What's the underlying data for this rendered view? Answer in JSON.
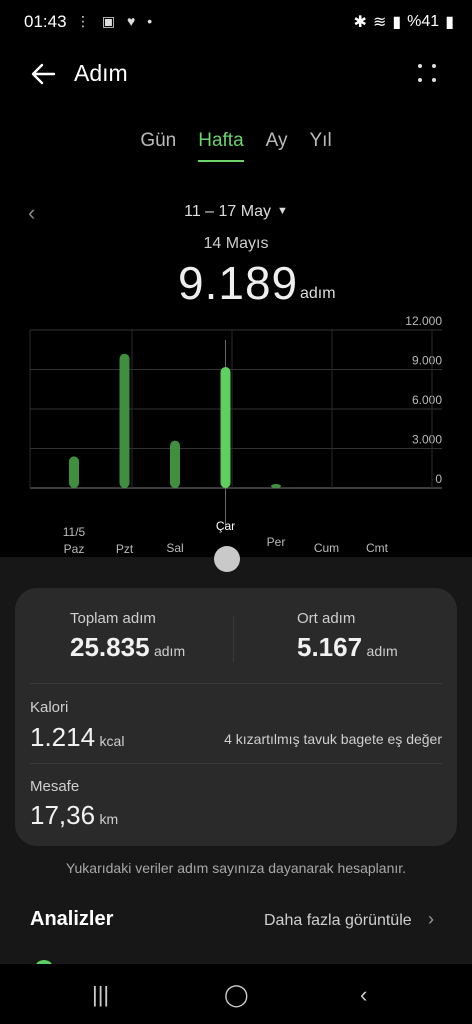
{
  "status_bar": {
    "time": "01:43",
    "left_icons": "⋮ ▣ ♥ •",
    "right_text": "%41"
  },
  "header": {
    "title": "Adım"
  },
  "tabs": [
    {
      "label": "Gün",
      "active": false
    },
    {
      "label": "Hafta",
      "active": true
    },
    {
      "label": "Ay",
      "active": false
    },
    {
      "label": "Yıl",
      "active": false
    }
  ],
  "range": {
    "label": "11 – 17 May"
  },
  "selected": {
    "day": "14 Mayıs",
    "value": "9.189",
    "unit": "adım"
  },
  "chart_data": {
    "type": "bar",
    "categories": [
      "Paz",
      "Pzt",
      "Sal",
      "Çar",
      "Per",
      "Cum",
      "Cmt"
    ],
    "date_label": "11/5",
    "values": [
      2400,
      10200,
      3600,
      9189,
      300,
      0,
      0
    ],
    "ylim": [
      0,
      12000
    ],
    "yticks": [
      "12.000",
      "9.000",
      "6.000",
      "3.000",
      "0"
    ],
    "selected_index": 3,
    "bar_color": "#3f8f3f",
    "selected_color": "#5fcf5f"
  },
  "summary": {
    "total_label": "Toplam adım",
    "total_value": "25.835",
    "total_unit": "adım",
    "avg_label": "Ort adım",
    "avg_value": "5.167",
    "avg_unit": "adım",
    "calorie_label": "Kalori",
    "calorie_value": "1.214",
    "calorie_unit": "kcal",
    "calorie_equiv": "4 kızartılmış tavuk bagete eş değer",
    "distance_label": "Mesafe",
    "distance_value": "17,36",
    "distance_unit": "km"
  },
  "footnote": "Yukarıdaki veriler adım sayınıza dayanarak hesaplanır.",
  "analysis": {
    "title": "Analizler",
    "more": "Daha fazla görüntüle"
  },
  "nav": {
    "recent": "|||",
    "home": "◯",
    "back": "‹"
  }
}
